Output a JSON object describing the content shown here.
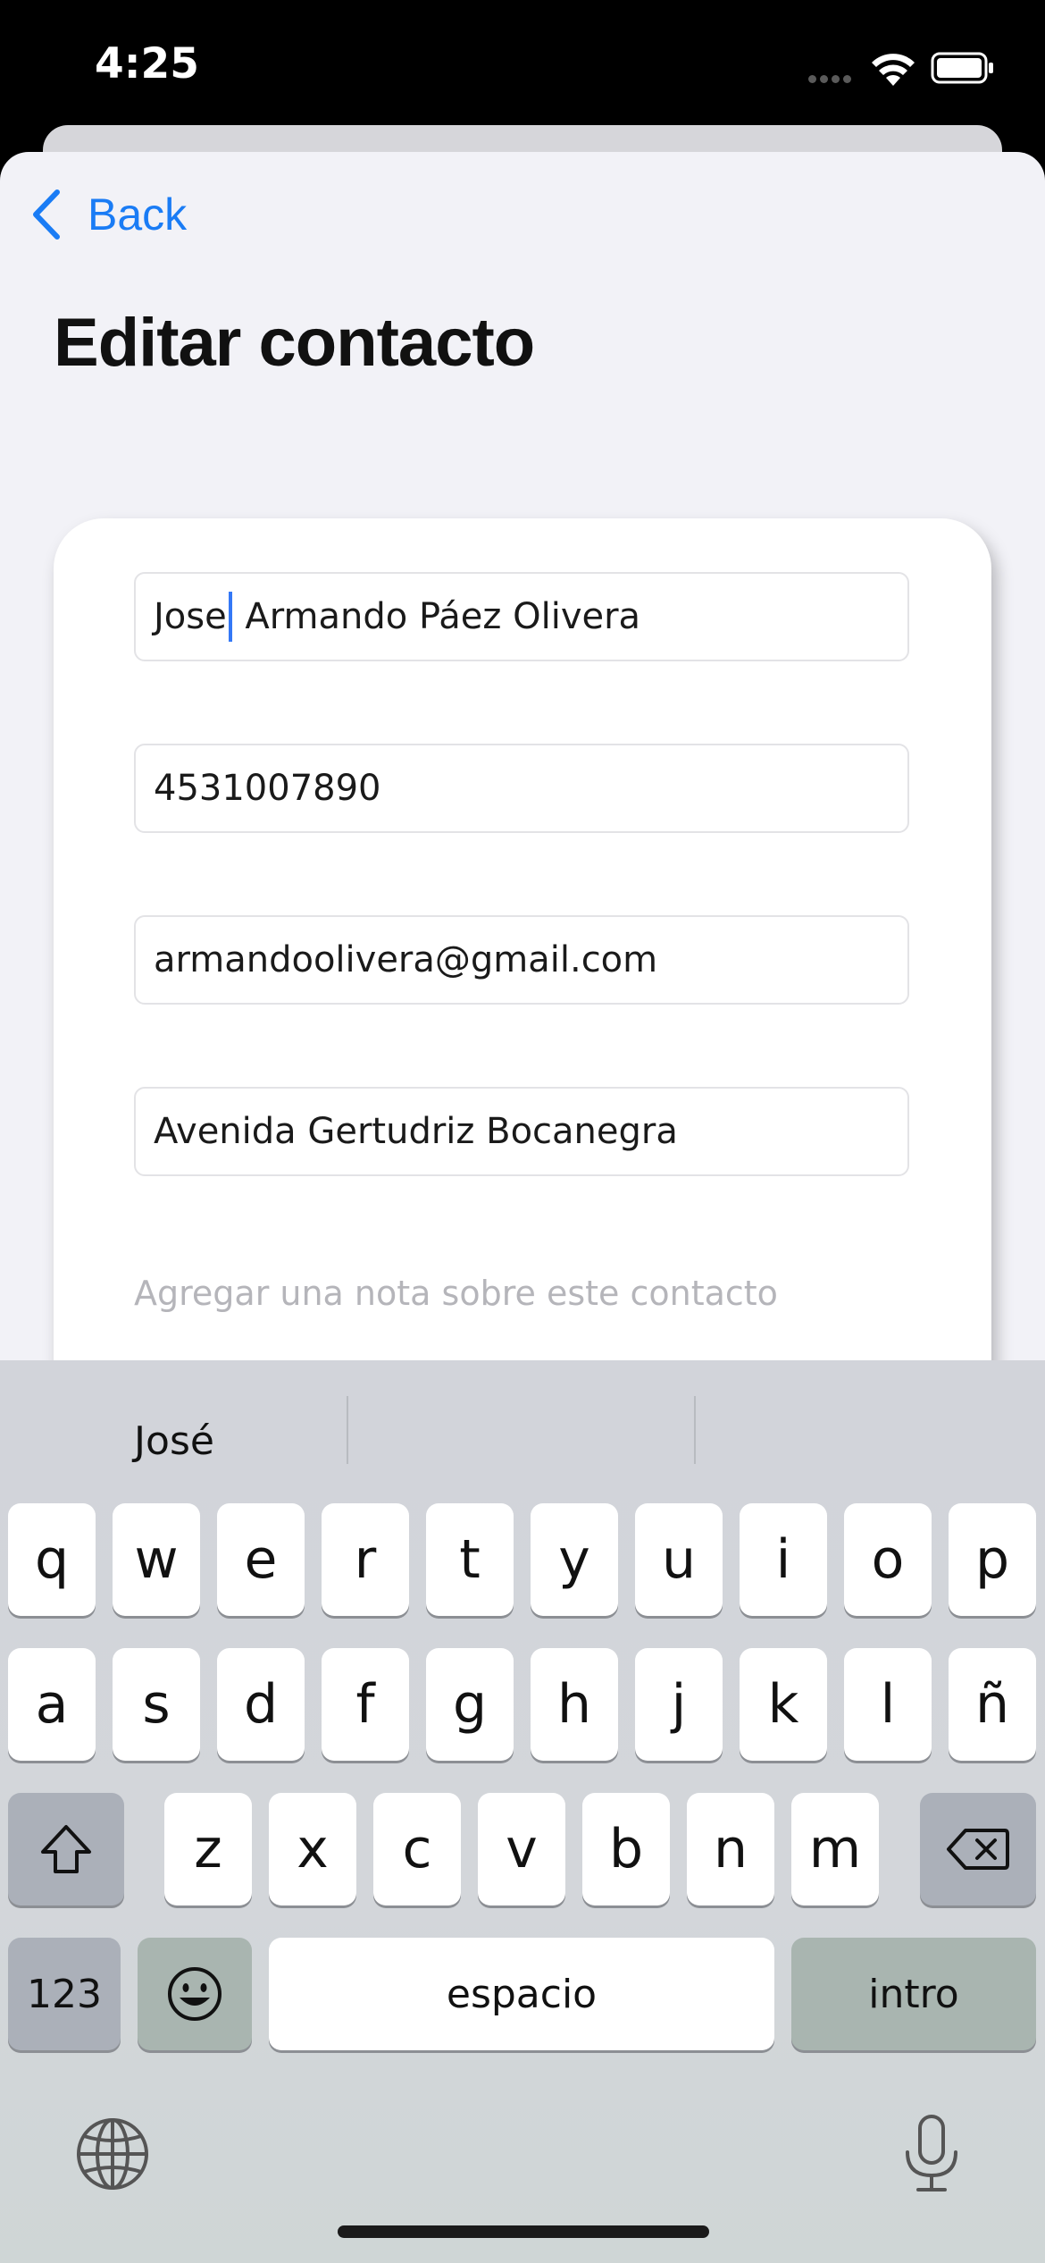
{
  "status_bar": {
    "time": "4:25",
    "signal_icon": "cellular-dots-icon",
    "wifi_icon": "wifi-icon",
    "battery_icon": "battery-icon"
  },
  "nav": {
    "back_label": "Back",
    "back_icon": "chevron-left-icon"
  },
  "page": {
    "title": "Editar contacto"
  },
  "form": {
    "name_before_caret": "Jose",
    "name_after_caret": " Armando Páez Olivera",
    "phone": "4531007890",
    "email": "armandoolivera@gmail.com",
    "address": "Avenida Gertudriz Bocanegra",
    "note_placeholder": "Agregar una nota sobre este contacto"
  },
  "keyboard": {
    "suggestions": [
      "José",
      "",
      ""
    ],
    "row1": [
      "q",
      "w",
      "e",
      "r",
      "t",
      "y",
      "u",
      "i",
      "o",
      "p"
    ],
    "row2": [
      "a",
      "s",
      "d",
      "f",
      "g",
      "h",
      "j",
      "k",
      "l",
      "ñ"
    ],
    "row3": [
      "z",
      "x",
      "c",
      "v",
      "b",
      "n",
      "m"
    ],
    "numbers_label": "123",
    "space_label": "espacio",
    "return_label": "intro",
    "shift_icon": "shift-icon",
    "delete_icon": "delete-backspace-icon",
    "emoji_icon": "emoji-icon",
    "globe_icon": "globe-icon",
    "mic_icon": "microphone-icon"
  },
  "colors": {
    "accent": "#1a7cf5",
    "caret": "#3478f6",
    "sheet_bg": "#f2f2f7",
    "placeholder": "#b5b5ba"
  }
}
